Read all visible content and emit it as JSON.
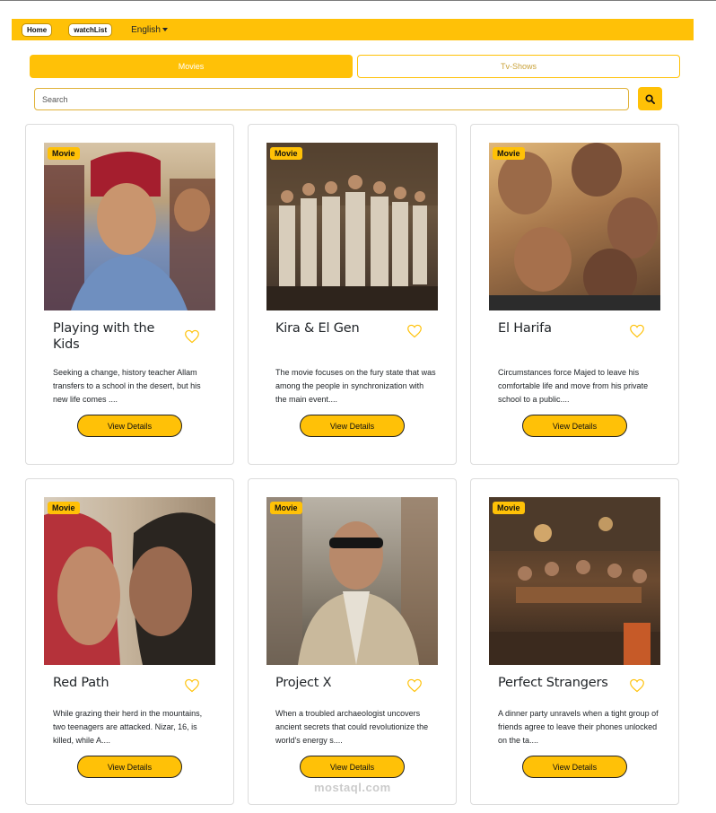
{
  "nav": {
    "home_label": "Home",
    "watchlist_label": "watchList",
    "language_label": "English"
  },
  "tabs": {
    "movies_label": "Movies",
    "tvshows_label": "Tv-Shows"
  },
  "search": {
    "placeholder": "Search"
  },
  "colors": {
    "accent": "#ffc107",
    "card_border": "#dcdcdc",
    "text": "#212529"
  },
  "cards": [
    {
      "badge": "Movie",
      "title": "Playing with the Kids",
      "description": "Seeking a change, history teacher Allam transfers to a school in the desert, but his new life comes ....",
      "button": "View Details"
    },
    {
      "badge": "Movie",
      "title": "Kira & El Gen",
      "description": "The movie focuses on the fury state that was among the people in synchronization with the main event....",
      "button": "View Details"
    },
    {
      "badge": "Movie",
      "title": "El Harifa",
      "description": "Circumstances force Majed to leave his comfortable life and move from his private school to a public....",
      "button": "View Details"
    },
    {
      "badge": "Movie",
      "title": "Red Path",
      "description": "While grazing their herd in the mountains, two teenagers are attacked. Nizar, 16, is killed, while A....",
      "button": "View Details"
    },
    {
      "badge": "Movie",
      "title": "Project X",
      "description": "When a troubled archaeologist uncovers ancient secrets that could revolutionize the world's energy s....",
      "button": "View Details"
    },
    {
      "badge": "Movie",
      "title": "Perfect Strangers",
      "description": "A dinner party unravels when a tight group of friends agree to leave their phones unlocked on the ta....",
      "button": "View Details"
    }
  ],
  "watermark": "mostaql.com"
}
